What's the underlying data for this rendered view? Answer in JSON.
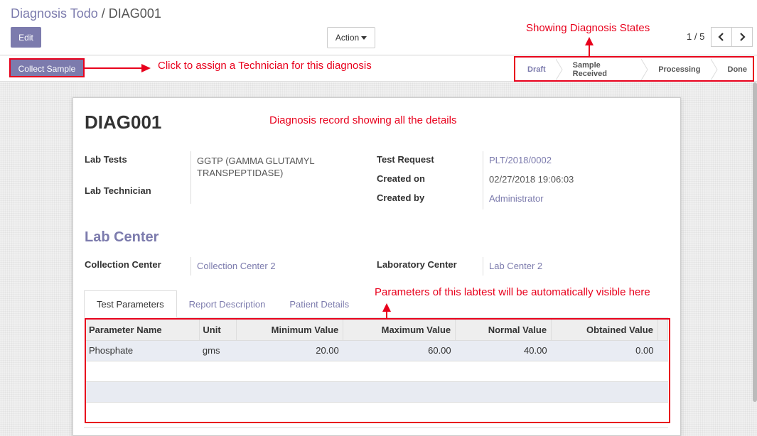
{
  "breadcrumb": {
    "parent": "Diagnosis Todo",
    "separator": "/",
    "current": "DIAG001"
  },
  "toolbar": {
    "edit_label": "Edit",
    "action_label": "Action"
  },
  "pager": {
    "value": "1 / 5"
  },
  "statusbar": {
    "collect_label": "Collect Sample",
    "steps": [
      "Draft",
      "Sample Received",
      "Processing",
      "Done"
    ],
    "active_step": "Draft"
  },
  "record": {
    "title": "DIAG001",
    "lab_tests_label": "Lab Tests",
    "lab_tests_value_line1": "GGTP (GAMMA GLUTAMYL",
    "lab_tests_value_line2": "TRANSPEPTIDASE)",
    "lab_technician_label": "Lab Technician",
    "test_request_label": "Test Request",
    "test_request_value": "PLT/2018/0002",
    "created_on_label": "Created on",
    "created_on_value": "02/27/2018 19:06:03",
    "created_by_label": "Created by",
    "created_by_value": "Administrator",
    "lab_center_section": "Lab Center",
    "collection_center_label": "Collection Center",
    "collection_center_value": "Collection Center 2",
    "laboratory_center_label": "Laboratory Center",
    "laboratory_center_value": "Lab Center 2"
  },
  "tabs": [
    "Test Parameters",
    "Report Description",
    "Patient Details"
  ],
  "table": {
    "headers": [
      "Parameter Name",
      "Unit",
      "Minimum Value",
      "Maximum Value",
      "Normal Value",
      "Obtained Value"
    ],
    "rows": [
      {
        "name": "Phosphate",
        "unit": "gms",
        "min": "20.00",
        "max": "60.00",
        "normal": "40.00",
        "obtained": "0.00"
      }
    ]
  },
  "annotations": {
    "collect": "Click to assign a Technician for this diagnosis",
    "states": "Showing Diagnosis States",
    "record": "Diagnosis record showing all the details",
    "params": "Parameters of this labtest will be automatically visible here"
  },
  "colors": {
    "accent": "#7c7bad",
    "annotation": "#e8001c"
  }
}
